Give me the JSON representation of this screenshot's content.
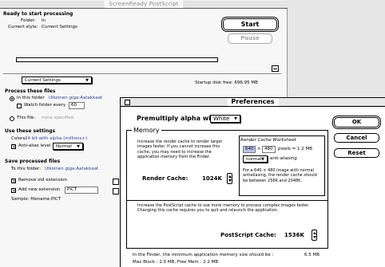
{
  "main_window": {
    "title": "ScreenReady PostScript",
    "status": "Ready to start processing",
    "folder_label": "Folder:",
    "folder_value": "In",
    "style_label": "Current style:",
    "style_value": "Current Settings",
    "start_button": "Start",
    "pause_button": "Pause",
    "progress_percent": 0,
    "settings_popup": "Current Settings",
    "startup_disk_free": "Startup disk free: 696.95 MB",
    "process_heading": "Process these files",
    "in_this_folder_label": "In this folder",
    "in_this_folder_path": "Ulkoinen giga:Aatakkaat",
    "watch_folder_label": "Watch folder every",
    "watch_folder_value": "60",
    "this_file_label": "This file:",
    "this_file_value": "none specified",
    "settings_heading": "Use these settings",
    "colors_label": "Colors:",
    "colors_value": "24 bit with alpha (millions+)",
    "antialias_label": "Anti-alias level",
    "antialias_value": "Normal",
    "save_heading": "Save processed files",
    "to_this_folder_label": "To this folder:",
    "to_this_folder_value": "Ulkoinen giga:Aatakkaat",
    "remove_ext_label": "Remove old extension",
    "add_ext_label": "Add new extension",
    "add_ext_value": "PICT",
    "sample_label": "Sample: filename.PICT"
  },
  "preferences": {
    "title": "Preferences",
    "premultiply_label": "Premultiply alpha with",
    "premultiply_value": "White",
    "ok_button": "OK",
    "cancel_button": "Cancel",
    "reset_button": "Reset",
    "memory_legend": "Memory",
    "render_cache_help": "Increase the render cache to render larger images faster. If you cannot increase this cache, you may need to increase the application memory from the Finder.",
    "render_cache_label": "Render Cache:",
    "render_cache_value": "1024K",
    "worksheet_title": "Render Cache Worksheet",
    "worksheet_width": "640",
    "worksheet_times": "×",
    "worksheet_height": "480",
    "worksheet_pixels": "pixels = 1.2 MB",
    "worksheet_aa_popup": "normal",
    "worksheet_aa_label": "anti-aliasing",
    "worksheet_note": "For a 640 × 480 image with normal antialiasing, the render cache should be between 256K and 2048K.",
    "ps_cache_help": "Increase the PostScript cache to use more memory to process complex images faster. Changing this cache requires you to quit and relaunch the application.",
    "ps_cache_label": "PostScript Cache:",
    "ps_cache_value": "1536K",
    "finder_note": "In the Finder, the minimum application memory size should be :",
    "finder_note_value": "6.5 MB",
    "max_block": "Max Block : 2.0 MB, Free Mem : 2.2 MB"
  }
}
